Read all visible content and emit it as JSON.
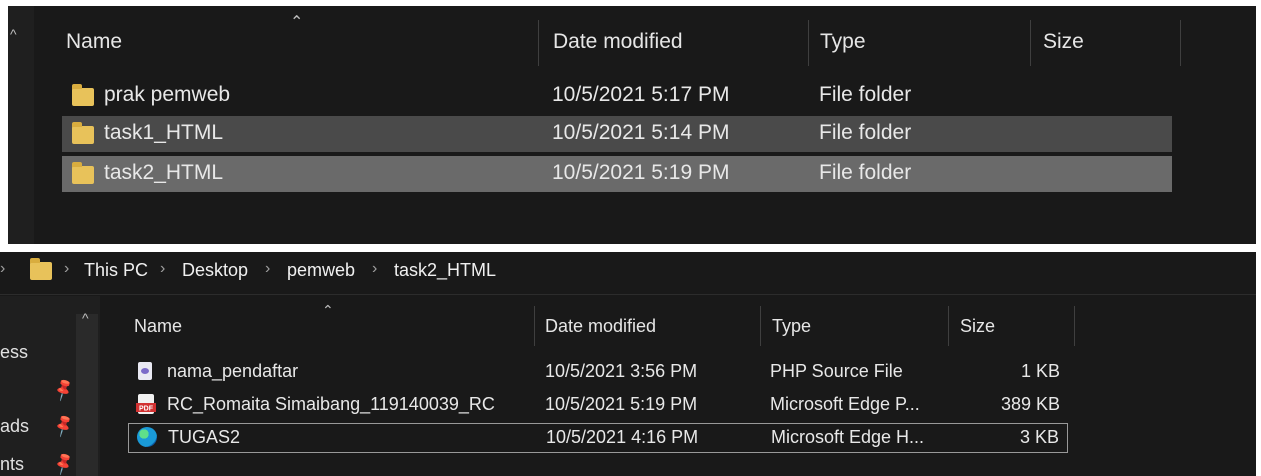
{
  "top_pane": {
    "columns": {
      "name": "Name",
      "date": "Date modified",
      "type": "Type",
      "size": "Size"
    },
    "rows": [
      {
        "name": "prak pemweb",
        "date": "10/5/2021 5:17 PM",
        "type": "File folder",
        "icon": "folder-icon"
      },
      {
        "name": "task1_HTML",
        "date": "10/5/2021 5:14 PM",
        "type": "File folder",
        "icon": "folder-icon"
      },
      {
        "name": "task2_HTML",
        "date": "10/5/2021 5:19 PM",
        "type": "File folder",
        "icon": "folder-icon"
      }
    ]
  },
  "bottom_pane": {
    "breadcrumb": [
      "This PC",
      "Desktop",
      "pemweb",
      "task2_HTML"
    ],
    "nav_items": [
      "ess",
      "ads",
      "nts"
    ],
    "columns": {
      "name": "Name",
      "date": "Date modified",
      "type": "Type",
      "size": "Size"
    },
    "rows": [
      {
        "name": "nama_pendaftar",
        "date": "10/5/2021 3:56 PM",
        "type": "PHP Source File",
        "size": "1 KB",
        "icon": "php-file-icon"
      },
      {
        "name": "RC_Romaita Simaibang_119140039_RC",
        "date": "10/5/2021 5:19 PM",
        "type": "Microsoft Edge P...",
        "size": "389 KB",
        "icon": "pdf-file-icon"
      },
      {
        "name": "TUGAS2",
        "date": "10/5/2021 4:16 PM",
        "type": "Microsoft Edge H...",
        "size": "3 KB",
        "icon": "edge-html-icon"
      }
    ],
    "pdf_badge": "PDF"
  },
  "colors": {
    "background": "#191919",
    "selected_row": "#4a4a4a",
    "hover_row": "#333333",
    "focus_border": "#999999",
    "folder": "#e8c25a"
  }
}
